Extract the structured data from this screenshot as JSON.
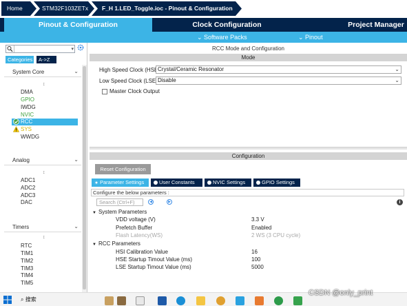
{
  "breadcrumb": [
    "Home",
    "STM32F103ZETx",
    "F_H 1.LED_Toggle.ioc - Pinout & Configuration"
  ],
  "main_tabs": [
    "Pinout & Configuration",
    "Clock Configuration",
    "Project Manager"
  ],
  "sub_menu": {
    "software_packs": "Software Packs",
    "pinout": "Pinout"
  },
  "left_panel": {
    "category_tabs": [
      "Categories",
      "A->Z"
    ],
    "sections": {
      "system_core": {
        "title": "System Core",
        "items": [
          "DMA",
          "GPIO",
          "IWDG",
          "NVIC",
          "RCC",
          "SYS",
          "WWDG"
        ]
      },
      "analog": {
        "title": "Analog",
        "items": [
          "ADC1",
          "ADC2",
          "ADC3",
          "DAC"
        ]
      },
      "timers": {
        "title": "Timers",
        "items": [
          "RTC",
          "TIM1",
          "TIM2",
          "TIM3",
          "TIM4",
          "TIM5"
        ]
      }
    }
  },
  "right_panel": {
    "title": "RCC Mode and Configuration",
    "mode_header": "Mode",
    "hse": {
      "label": "High Speed Clock (HSE)",
      "value": "Crystal/Ceramic Resonator"
    },
    "lse": {
      "label": "Low Speed Clock (LSE)",
      "value": "Disable"
    },
    "mco": {
      "label": "Master Clock Output",
      "checked": false
    },
    "config_header": "Configuration",
    "reset_button": "Reset Configuration",
    "config_tabs": [
      "Parameter Settings",
      "User Constants",
      "NVIC Settings",
      "GPIO Settings"
    ],
    "config_desc": "Configure the below parameters :",
    "search_placeholder": "Search (Ctrl+F)",
    "groups": {
      "system": {
        "title": "System Parameters",
        "params": [
          {
            "name": "VDD voltage (V)",
            "value": "3.3 V",
            "disabled": false
          },
          {
            "name": "Prefetch Buffer",
            "value": "Enabled",
            "disabled": false
          },
          {
            "name": "Flash Latency(WS)",
            "value": "2 WS (3 CPU cycle)",
            "disabled": true
          }
        ]
      },
      "rcc": {
        "title": "RCC Parameters",
        "params": [
          {
            "name": "HSI Calibration Value",
            "value": "16",
            "disabled": false
          },
          {
            "name": "HSE Startup Timout Value (ms)",
            "value": "100",
            "disabled": false
          },
          {
            "name": "LSE Startup Timout Value (ms)",
            "value": "5000",
            "disabled": false
          }
        ]
      }
    }
  },
  "taskbar": {
    "search_text": "搜索"
  },
  "watermark": "CSDN @only_print",
  "colors": {
    "dark_navy": "#03234b",
    "accent_blue": "#3cb4e6",
    "gpio_green": "#41a13f",
    "warn_yellow": "#d6b400"
  }
}
